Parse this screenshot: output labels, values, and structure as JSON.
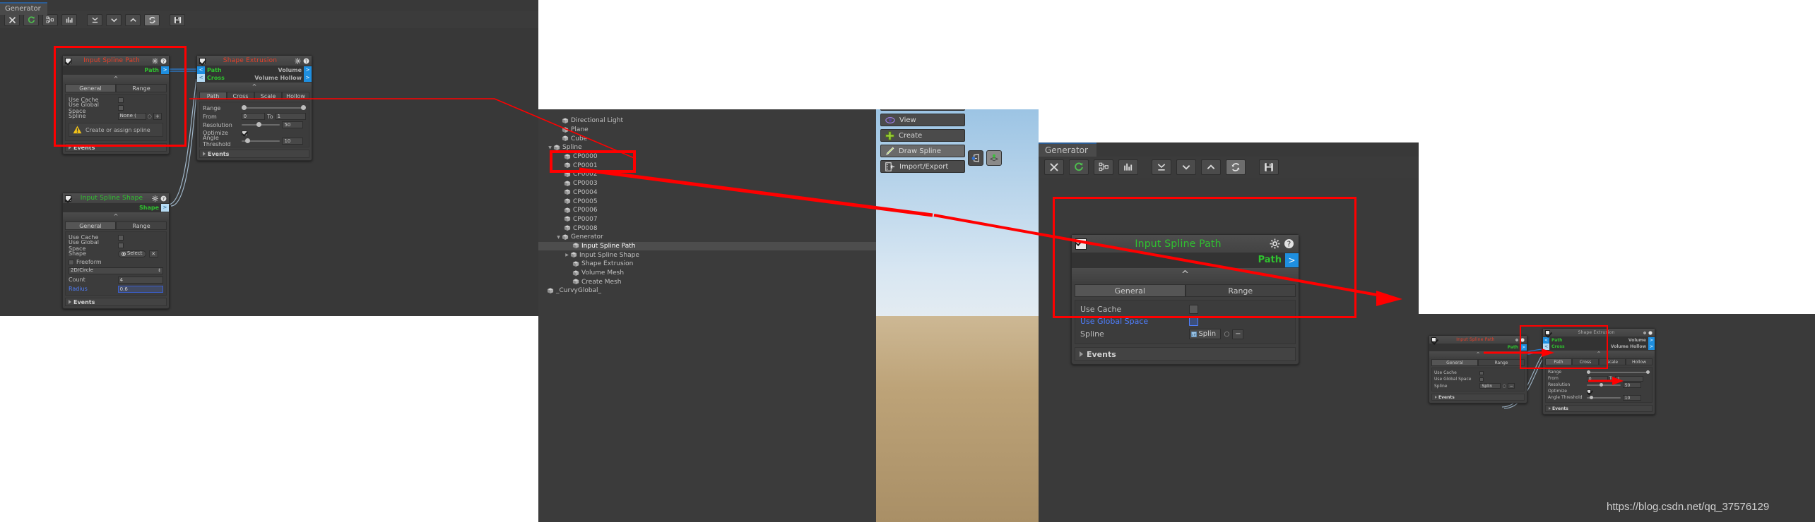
{
  "window": {
    "tab_label": "Generator",
    "toolbar_icons": [
      "close-icon",
      "refresh-icon",
      "hierarchy-icon",
      "stats-icon",
      "collapse-all-icon",
      "chevron-down-icon",
      "chevron-up-icon",
      "sync-icon",
      "save-icon"
    ]
  },
  "nodes": {
    "input_spline_path": {
      "title": "Input Spline Path",
      "output_slot": "Path",
      "output_arrow": ">",
      "collapse_glyph": "^",
      "tabs": [
        {
          "label": "General",
          "selected": true
        },
        {
          "label": "Range",
          "selected": false
        }
      ],
      "fields": [
        {
          "label": "Use Cache",
          "type": "checkbox",
          "checked": false
        },
        {
          "label": "Use Global Space",
          "type": "checkbox",
          "checked": false
        },
        {
          "label": "Spline",
          "type": "object",
          "value": "None (",
          "picker": "○",
          "extra": "+"
        }
      ],
      "warning": "Create or assign spline",
      "events_label": "Events"
    },
    "input_spline_path_right": {
      "title": "Input Spline Path",
      "output_slot": "Path",
      "output_arrow": ">",
      "collapse_glyph": "^",
      "tabs": [
        {
          "label": "General",
          "selected": true
        },
        {
          "label": "Range",
          "selected": false
        }
      ],
      "fields": [
        {
          "label": "Use Cache",
          "type": "checkbox",
          "checked": false,
          "highlight": false
        },
        {
          "label": "Use Global Space",
          "type": "checkbox",
          "checked": false,
          "highlight": true
        },
        {
          "label": "Spline",
          "type": "object",
          "value": "Splin",
          "picker": "○",
          "extra": "−"
        }
      ],
      "events_label": "Events"
    },
    "shape_extrusion": {
      "title": "Shape Extrusion",
      "inputs": [
        {
          "label": "Path",
          "arrow": "<",
          "pale": false
        },
        {
          "label": "Cross",
          "arrow": "<",
          "pale": true
        }
      ],
      "outputs": [
        {
          "label": "Volume",
          "arrow": ">",
          "pale": false
        },
        {
          "label": "Volume Hollow",
          "arrow": ">",
          "pale": false
        }
      ],
      "collapse_glyph": "^",
      "tabs": [
        {
          "label": "Path",
          "selected": true
        },
        {
          "label": "Cross",
          "selected": false
        },
        {
          "label": "Scale",
          "selected": false
        },
        {
          "label": "Hollow",
          "selected": false
        }
      ],
      "fields": [
        {
          "label": "Range",
          "type": "minmax"
        },
        {
          "label": "From",
          "type": "fromto",
          "from": "0",
          "to_label": "To",
          "to": "1"
        },
        {
          "label": "Resolution",
          "type": "slider",
          "value": "50",
          "pct": 38
        },
        {
          "label": "Optimize",
          "type": "checkbox",
          "checked": true
        },
        {
          "label": "Angle Threshold",
          "type": "slider",
          "value": "10",
          "pct": 8
        }
      ],
      "events_label": "Events"
    },
    "input_spline_shape": {
      "title": "Input Spline Shape",
      "output_slot": "Shape",
      "output_arrow": ">",
      "collapse_glyph": "^",
      "tabs": [
        {
          "label": "General",
          "selected": true
        },
        {
          "label": "Range",
          "selected": false
        }
      ],
      "fields": [
        {
          "label": "Use Cache",
          "type": "checkbox",
          "checked": false
        },
        {
          "label": "Use Global Space",
          "type": "checkbox",
          "checked": false
        },
        {
          "label": "Shape",
          "type": "select-clear",
          "value": "Select",
          "clear": "✕"
        },
        {
          "label": "Freeform",
          "type": "leftcheckbox",
          "checked": false
        },
        {
          "label": "",
          "type": "dropdown",
          "value": "2D/Circle"
        },
        {
          "label": "Count",
          "type": "text",
          "value": "4"
        },
        {
          "label": "Radius",
          "type": "text",
          "value": "0.6",
          "highlight": true
        }
      ],
      "events_label": "Events"
    }
  },
  "hierarchy": {
    "items": [
      {
        "label": "Directional Light",
        "depth": 1,
        "arrow": "",
        "selected": false
      },
      {
        "label": "Plane",
        "depth": 1,
        "arrow": "",
        "selected": false
      },
      {
        "label": "Cube",
        "depth": 1,
        "arrow": "",
        "selected": false
      },
      {
        "label": "Spline",
        "depth": 1,
        "arrow": "▼",
        "selected": false
      },
      {
        "label": "CP0000",
        "depth": 2,
        "arrow": "",
        "selected": false
      },
      {
        "label": "CP0001",
        "depth": 2,
        "arrow": "",
        "selected": false
      },
      {
        "label": "CP0002",
        "depth": 2,
        "arrow": "",
        "selected": false
      },
      {
        "label": "CP0003",
        "depth": 2,
        "arrow": "",
        "selected": false
      },
      {
        "label": "CP0004",
        "depth": 2,
        "arrow": "",
        "selected": false
      },
      {
        "label": "CP0005",
        "depth": 2,
        "arrow": "",
        "selected": false
      },
      {
        "label": "CP0006",
        "depth": 2,
        "arrow": "",
        "selected": false
      },
      {
        "label": "CP0007",
        "depth": 2,
        "arrow": "",
        "selected": false
      },
      {
        "label": "CP0008",
        "depth": 2,
        "arrow": "",
        "selected": false
      },
      {
        "label": "Generator",
        "depth": 2,
        "arrow": "▼",
        "selected": false
      },
      {
        "label": "Input Spline Path",
        "depth": 3,
        "arrow": "",
        "selected": true
      },
      {
        "label": "Input Spline Shape",
        "depth": 3,
        "arrow": "▶",
        "selected": false
      },
      {
        "label": "Shape Extrusion",
        "depth": 3,
        "arrow": "",
        "selected": false
      },
      {
        "label": "Volume Mesh",
        "depth": 3,
        "arrow": "",
        "selected": false
      },
      {
        "label": "Create Mesh",
        "depth": 3,
        "arrow": "",
        "selected": false
      },
      {
        "label": "_CurvyGlobal_",
        "depth": 1,
        "arrow": "",
        "selected": false
      }
    ]
  },
  "scene": {
    "buttons": [
      {
        "label": "View",
        "icon": "eye-icon"
      },
      {
        "label": "Create",
        "icon": "plus-icon"
      },
      {
        "label": "Draw Spline",
        "icon": "pencil-icon"
      },
      {
        "label": "Import/Export",
        "icon": "import-export-icon"
      }
    ],
    "tool_buttons": [
      "pivot-rotation-icon",
      "pivot-center-icon"
    ]
  },
  "watermark": "https://blog.csdn.net/qq_37576129",
  "colors": {
    "annotation_red": "#ff0000",
    "slot_blue": "#1e8fe0",
    "slot_pale": "#b6dcf5",
    "title_red": "#e8402a",
    "title_green": "#2fc22f",
    "panel_bg": "#3b3b3b",
    "highlight_blue": "#4f7fff"
  }
}
